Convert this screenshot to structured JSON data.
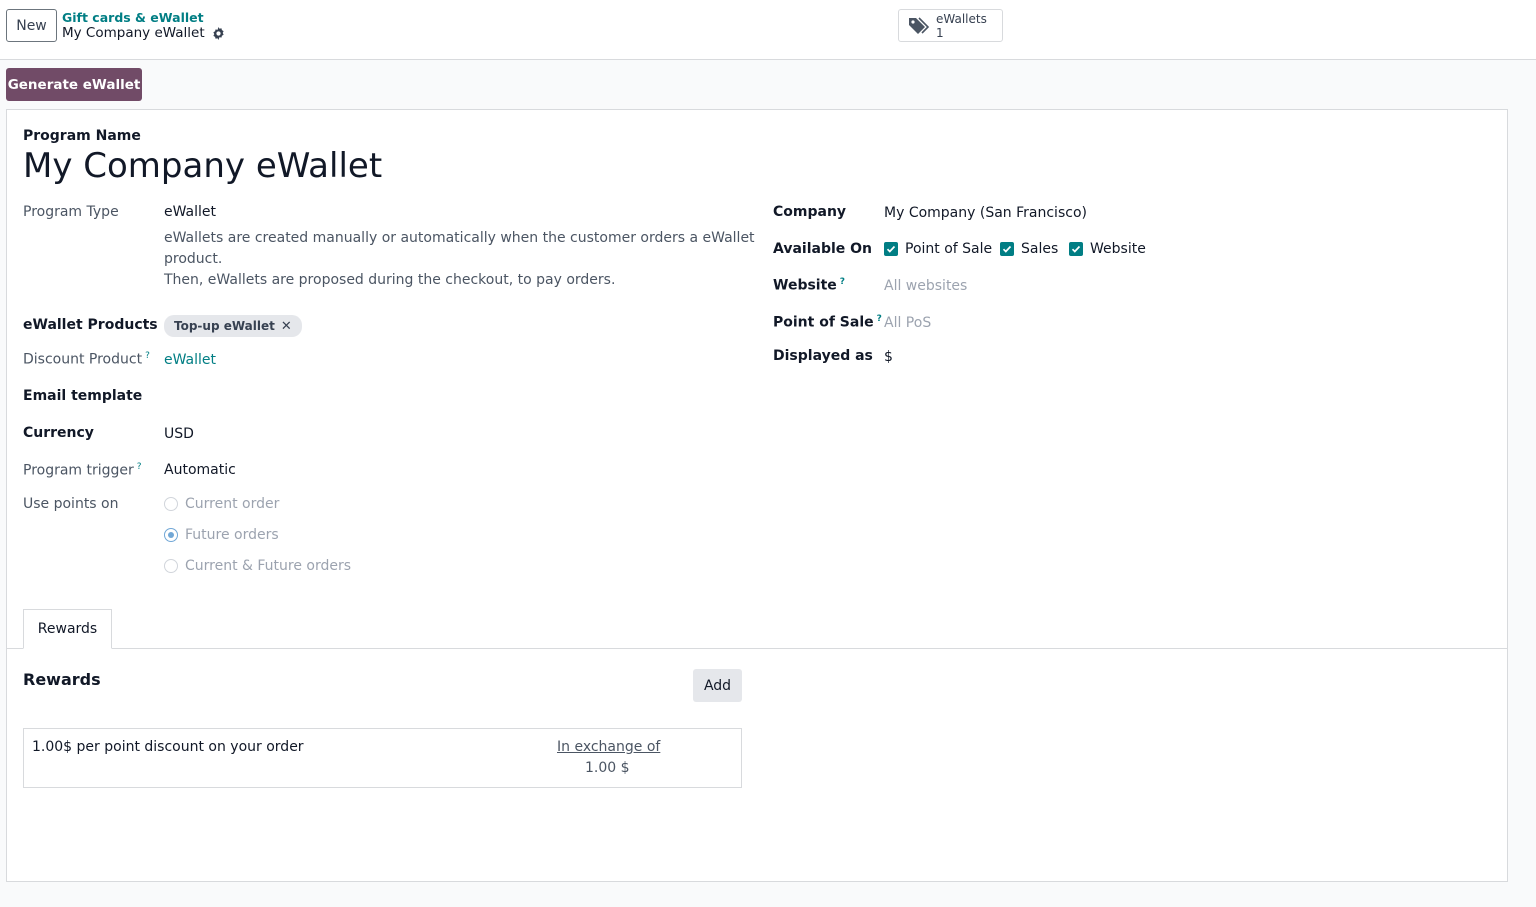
{
  "control_panel": {
    "new_label": "New",
    "breadcrumb_parent": "Gift cards & eWallet",
    "breadcrumb_current": "My Company eWallet",
    "smart_button": {
      "label": "eWallets",
      "value": "1"
    }
  },
  "actions": {
    "generate_label": "Generate eWallet"
  },
  "form": {
    "program_name_label": "Program Name",
    "program_name": "My Company eWallet",
    "program_type_label": "Program Type",
    "program_type": "eWallet",
    "program_type_help_1": "eWallets are created manually or automatically when the customer orders a eWallet",
    "program_type_help_2": "product.",
    "program_type_help_3": "Then, eWallets are proposed during the checkout, to pay orders.",
    "ewallet_products_label": "eWallet Products",
    "ewallet_products": [
      "Top-up eWallet"
    ],
    "discount_product_label": "Discount Product",
    "discount_product": "eWallet",
    "email_template_label": "Email template",
    "currency_label": "Currency",
    "currency": "USD",
    "program_trigger_label": "Program trigger",
    "program_trigger": "Automatic",
    "use_points_on_label": "Use points on",
    "use_points_on_options": [
      "Current order",
      "Future orders",
      "Current & Future orders"
    ],
    "use_points_on_selected": "Future orders",
    "company_label": "Company",
    "company": "My Company (San Francisco)",
    "available_on_label": "Available On",
    "available_on": [
      {
        "label": "Point of Sale",
        "checked": true
      },
      {
        "label": "Sales",
        "checked": true
      },
      {
        "label": "Website",
        "checked": true
      }
    ],
    "website_label": "Website",
    "website_placeholder": "All websites",
    "pos_label": "Point of Sale",
    "pos_placeholder": "All PoS",
    "displayed_as_label": "Displayed as",
    "displayed_as": "$",
    "help_mark": "?"
  },
  "tabs": [
    {
      "label": "Rewards",
      "active": true
    }
  ],
  "rewards": {
    "heading": "Rewards",
    "add_label": "Add",
    "items": [
      {
        "description": "1.00$ per point discount on your order",
        "exchange_label": "In exchange of",
        "exchange_value": "1.00 $"
      }
    ]
  },
  "colors": {
    "primary": "#714b67",
    "link": "#017e84",
    "checkbox": "#017e84"
  }
}
